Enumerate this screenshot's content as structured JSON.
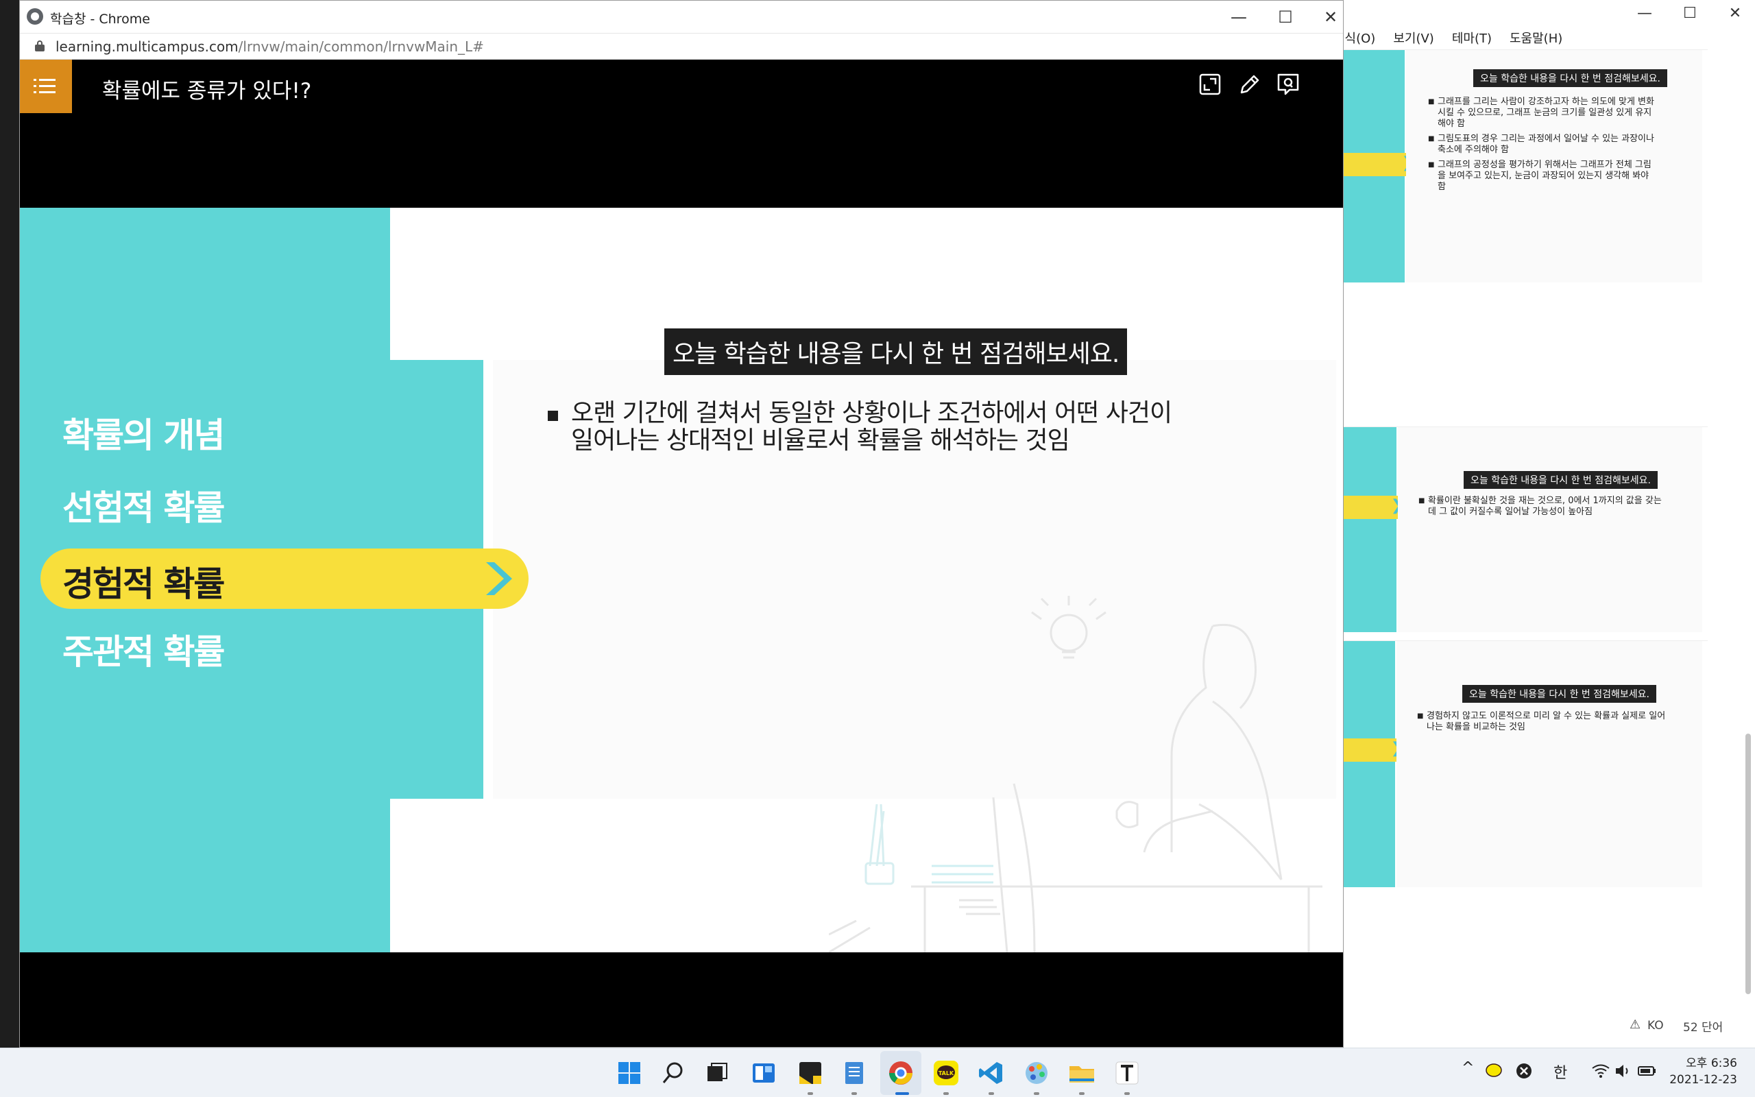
{
  "window": {
    "title": "학습창 - Chrome",
    "url_host": "learning.multicampus.com",
    "url_path": "/lrnvw/main/common/lrnvwMain_L#"
  },
  "player": {
    "lesson_title": "확률에도 종류가 있다!?",
    "header_icons": [
      "fullscreen-icon",
      "pen-icon",
      "qna-icon"
    ]
  },
  "slide": {
    "nav_items": [
      "확률의 개념",
      "선험적 확률",
      "경험적 확률",
      "주관적 확률"
    ],
    "active_index": 2,
    "heading": "오늘 학습한 내용을 다시 한 번 점검해보세요.",
    "bullet_line1": "오랜 기간에 걸쳐서 동일한 상황이나 조건하에서 어떤 사건이",
    "bullet_line2": "일어나는 상대적인 비율로서 확률을 해석하는 것임"
  },
  "background_app": {
    "menu": [
      "서식(O)",
      "보기(V)",
      "테마(T)",
      "도움말(H)"
    ],
    "thumbs": [
      {
        "heading": "오늘 학습한 내용을 다시 한 번 점검해보세요.",
        "bullets": [
          "그래프를 그리는 사람이 강조하고자 하는 의도에 맞게 변화시킬 수 있으므로, 그래프 눈금의 크기를 일관성 있게 유지해야 함",
          "그림도표의 경우 그리는 과정에서 일어날 수 있는 과장이나 축소에 주의해야 함",
          "그래프의 공정성을 평가하기 위해서는 그래프가 전체 그림을 보여주고 있는지, 눈금이 과장되어 있는지 생각해 봐야 함"
        ]
      },
      {
        "heading": "오늘 학습한 내용을 다시 한 번 점검해보세요.",
        "bullets": [
          "확률이란 불확실한 것을 재는 것으로, 0에서 1까지의 값을 갖는데 그 값이 커질수록 일어날 가능성이 높아짐"
        ]
      },
      {
        "heading": "오늘 학습한 내용을 다시 한 번 점검해보세요.",
        "bullets": [
          "경험하지 않고도 이론적으로 미리 알 수 있는 확률과 실제로 일어나는 확률을 비교하는 것임"
        ]
      }
    ],
    "status_lang": "KO",
    "status_words": "52 단어"
  },
  "taskbar": {
    "apps": [
      "start-icon",
      "search-icon",
      "task-view-icon",
      "widgets-icon",
      "sticky-notes-icon",
      "notepad-icon",
      "chrome-icon",
      "kakaotalk-icon",
      "vscode-icon",
      "paint-icon",
      "file-explorer-icon",
      "typora-icon"
    ],
    "ime": "한",
    "time": "오후 6:36",
    "date": "2021-12-23"
  },
  "colors": {
    "teal": "#5fd6d6",
    "yellow": "#f8df3b",
    "menu_orange": "#d98a1a",
    "arrow_blue": "#49c4d2"
  }
}
